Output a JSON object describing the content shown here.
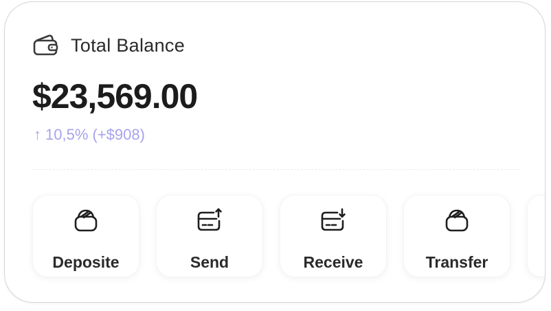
{
  "balance_card": {
    "title": "Total Balance",
    "title_icon": "wallet-icon",
    "amount": "$23,569.00",
    "change": {
      "arrow": "↑",
      "text": "10,5% (+$908)",
      "color": "#a6a3ec"
    }
  },
  "actions": [
    {
      "label": "Deposite",
      "icon": "deposit-icon"
    },
    {
      "label": "Send",
      "icon": "send-card-icon"
    },
    {
      "label": "Receive",
      "icon": "receive-card-icon"
    },
    {
      "label": "Transfer",
      "icon": "transfer-icon"
    }
  ],
  "colors": {
    "accent": "#a6a3ec",
    "text": "#1c1c1c",
    "border": "#d6d6d6"
  }
}
